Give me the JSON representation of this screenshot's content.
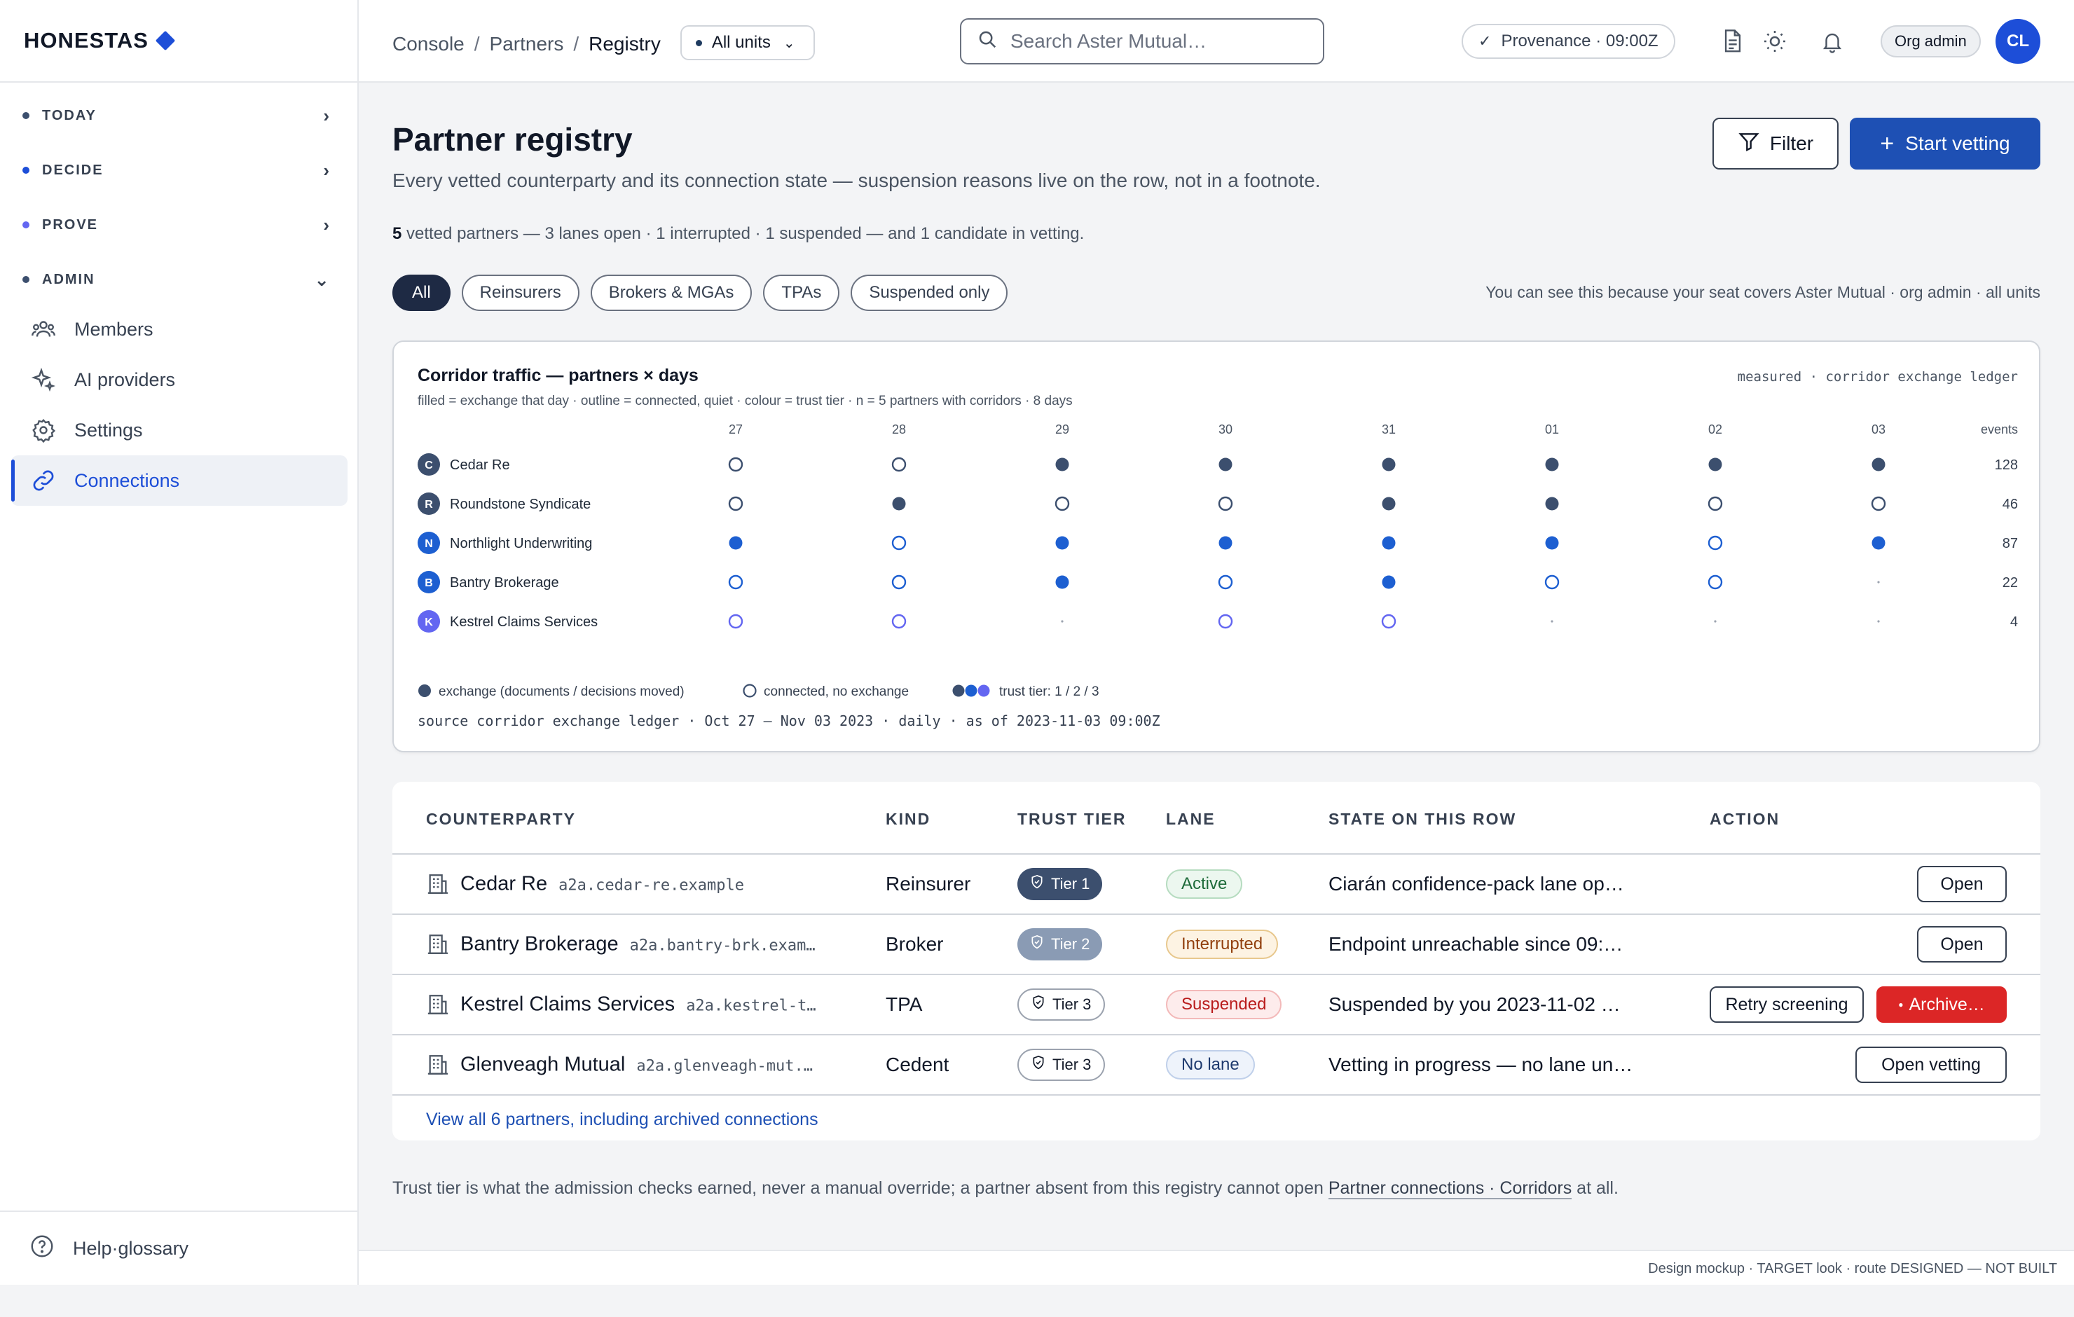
{
  "brand": {
    "name": "HONESTAS"
  },
  "sidebar": {
    "sections": [
      {
        "label": "TODAY",
        "dot_color": "#3c4f6e"
      },
      {
        "label": "DECIDE",
        "dot_color": "#1d4ed8"
      },
      {
        "label": "PROVE",
        "dot_color": "#6366f1"
      },
      {
        "label": "ADMIN",
        "dot_color": "#3c4f6e"
      }
    ],
    "items": [
      {
        "label": "Members",
        "icon": "users-icon"
      },
      {
        "label": "AI providers",
        "icon": "sparkle-icon"
      },
      {
        "label": "Settings",
        "icon": "gear-icon"
      },
      {
        "label": "Connections",
        "icon": "link-icon"
      }
    ],
    "help": "Help·glossary"
  },
  "topbar": {
    "breadcrumb": [
      "Console",
      "Partners",
      "Registry"
    ],
    "units": "All units",
    "search_placeholder": "Search Aster Mutual…",
    "provenance": "Provenance · 09:00Z",
    "role": "Org admin",
    "avatar": "CL"
  },
  "page": {
    "title": "Partner registry",
    "subtitle": "Every vetted counterparty and its connection state — suspension reasons live on the row, not in a footnote.",
    "filter_label": "Filter",
    "start_label": "Start vetting",
    "summary_count": "5",
    "summary_rest": " vetted partners — 3 lanes open · 1 interrupted · 1 suspended — and 1 candidate in vetting.",
    "chips": [
      "All",
      "Reinsurers",
      "Brokers & MGAs",
      "TPAs",
      "Suspended only"
    ],
    "seat_note": "You can see this because your seat covers Aster Mutual · org admin · all units"
  },
  "chart_data": {
    "type": "heatmap",
    "title": "Corridor traffic — partners × days",
    "subtitle": "filled = exchange that day · outline = connected, quiet · colour = trust tier · n = 5 partners with corridors · 8 days",
    "measured_note": "measured · corridor exchange ledger",
    "days": [
      "27",
      "28",
      "29",
      "30",
      "31",
      "01",
      "02",
      "03"
    ],
    "events_label": "events",
    "rows": [
      {
        "partner": "Cedar Re",
        "initial": "C",
        "tier": 1,
        "cells": [
          "o",
          "o",
          "f",
          "f",
          "f",
          "f",
          "f",
          "f"
        ],
        "events": "128"
      },
      {
        "partner": "Roundstone Syndicate",
        "initial": "R",
        "tier": 1,
        "cells": [
          "o",
          "f",
          "o",
          "o",
          "f",
          "f",
          "o",
          "o"
        ],
        "events": "46"
      },
      {
        "partner": "Northlight Underwriting",
        "initial": "N",
        "tier": 2,
        "cells": [
          "f",
          "o",
          "f",
          "f",
          "f",
          "f",
          "o",
          "f"
        ],
        "events": "87"
      },
      {
        "partner": "Bantry Brokerage",
        "initial": "B",
        "tier": 2,
        "cells": [
          "o",
          "o",
          "f",
          "o",
          "f",
          "o",
          "o",
          "-"
        ],
        "events": "22"
      },
      {
        "partner": "Kestrel Claims Services",
        "initial": "K",
        "tier": 3,
        "cells": [
          "o",
          "o",
          "-",
          "o",
          "o",
          "-",
          "-",
          "-"
        ],
        "events": "4"
      }
    ],
    "tier_colors": {
      "1": "#3c4f6e",
      "2": "#1d5fd1",
      "3": "#6366f1"
    },
    "legend": {
      "filled": "exchange (documents / decisions moved)",
      "outline": "connected, no exchange",
      "tier": "trust tier: 1 / 2 / 3"
    },
    "source": "source corridor exchange ledger · Oct 27 – Nov 03 2023 · daily · as of 2023-11-03 09:00Z"
  },
  "table": {
    "headers": [
      "COUNTERPARTY",
      "KIND",
      "TRUST TIER",
      "LANE",
      "STATE ON THIS ROW",
      "ACTION"
    ],
    "rows": [
      {
        "name": "Cedar Re",
        "domain": "a2a.cedar-re.example",
        "kind": "Reinsurer",
        "tier": "Tier 1",
        "lane": "Active",
        "state": "Ciarán confidence-pack lane op…",
        "actions": [
          "Open"
        ]
      },
      {
        "name": "Bantry Brokerage",
        "domain": "a2a.bantry-brk.exam…",
        "kind": "Broker",
        "tier": "Tier 2",
        "lane": "Interrupted",
        "state": "Endpoint unreachable since 09:…",
        "actions": [
          "Open"
        ]
      },
      {
        "name": "Kestrel Claims Services",
        "domain": "a2a.kestrel-t…",
        "kind": "TPA",
        "tier": "Tier 3",
        "lane": "Suspended",
        "state": "Suspended by you 2023-11-02 …",
        "actions": [
          "Retry screening",
          "Archive…"
        ]
      },
      {
        "name": "Glenveagh Mutual",
        "domain": "a2a.glenveagh-mut.…",
        "kind": "Cedent",
        "tier": "Tier 3",
        "lane": "No lane",
        "state": "Vetting in progress — no lane un…",
        "actions": [
          "Open vetting"
        ]
      }
    ],
    "view_all": "View all 6 partners, including archived connections"
  },
  "footnote": {
    "before": "Trust tier is what the admission checks earned, never a manual override; a partner absent from this registry cannot open ",
    "link": "Partner connections · Corridors",
    "after": " at all."
  },
  "bottom_note": "Design mockup · TARGET look · route DESIGNED — NOT BUILT"
}
